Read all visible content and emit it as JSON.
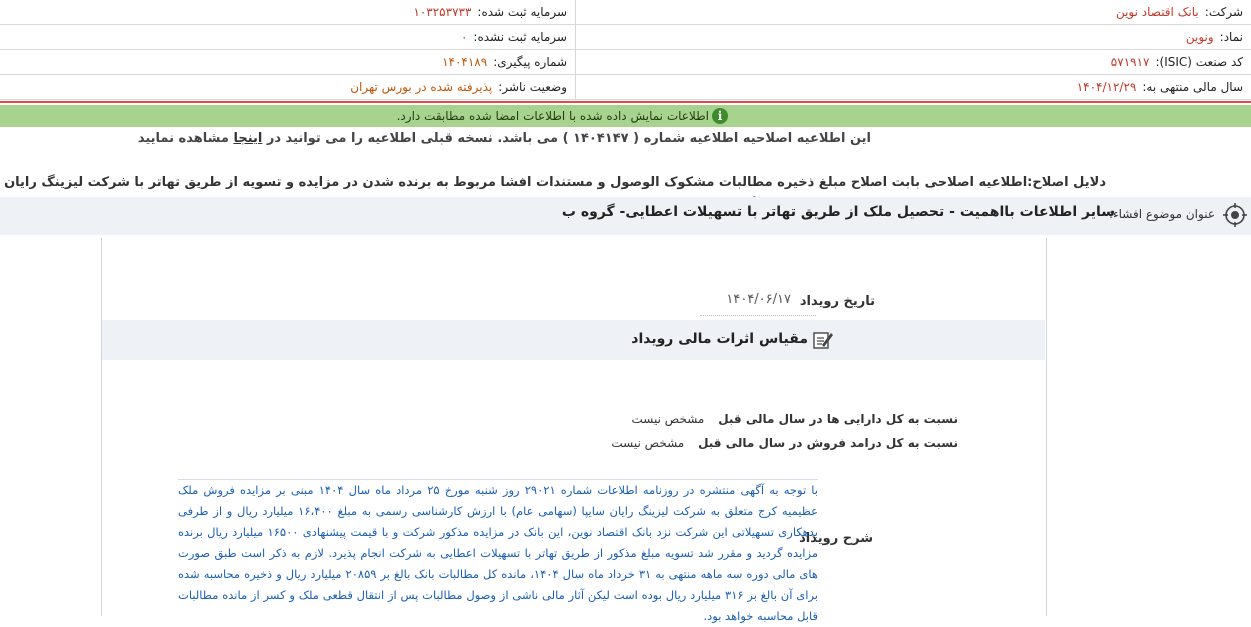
{
  "header": {
    "company_label": "شرکت:",
    "company_value": "بانک اقتصاد نوین",
    "symbol_label": "نماد:",
    "symbol_value": "ونوین",
    "isic_label": "کد صنعت (ISIC):",
    "isic_value": "۵۷۱۹۱۷",
    "fiscal_label": "سال مالی منتهی به:",
    "fiscal_value": "۱۴۰۴/۱۲/۲۹",
    "reg_capital_label": "سرمایه ثبت شده:",
    "reg_capital_value": "۱۰۳۲۵۳۷۳۳",
    "unreg_capital_label": "سرمایه ثبت نشده:",
    "unreg_capital_value": "۰",
    "tracking_label": "شماره پیگیری:",
    "tracking_value": "۱۴۰۴۱۸۹",
    "publisher_label": "وضعیت ناشر:",
    "publisher_value": "پذیرفته شده در بورس تهران"
  },
  "verify": {
    "icon": "info-icon",
    "text": "اطلاعات نمایش داده شده با اطلاعات امضا شده مطابقت دارد."
  },
  "amend": {
    "before": "این اطلاعیه اصلاحیه اطلاعیه شماره ( ۱۴۰۴۱۴۷ ) می باشد. نسخه قبلی اطلاعیه را می توانید در",
    "link": "اینجا",
    "after": "مشاهده نمایید"
  },
  "reasons": "دلایل اصلاح:اطلاعیه اصلاحی بابت اصلاح مبلغ ذخیره مطالبات مشکوک الوصول و مستندات افشا مربوط به برنده شدن در مزایده و تسویه از طریق تهاتر با شرکت لیزینگ رایان سایپا از طریق تهاتر با تسهیلات اعطایی به شرکت لیزینگ رایان سایپا می باشد.",
  "subject": {
    "label": "عنوان موضوع افشاء:",
    "value": "سایر اطلاعات بااهمیت - تحصیل ملک از طریق تهاتر با تسهیلات اعطایی- گروه ب"
  },
  "event": {
    "date_label": "تاریخ رویداد",
    "date_value": "۱۴۰۴/۰۶/۱۷"
  },
  "financial": {
    "title": "مقیاس اثرات مالی رویداد",
    "rows": [
      {
        "label": "نسبت به کل دارایی ها در سال مالی قبل",
        "value": "مشخص نیست"
      },
      {
        "label": "نسبت به کل درامد فروش در سال مالی قبل",
        "value": "مشخص نیست"
      }
    ]
  },
  "description": {
    "label": "شرح رویداد",
    "text": "با توجه به آگهی منتشره در روزنامه اطلاعات شماره ۲۹۰۲۱ روز شنبه مورخ ۲۵ مرداد ماه سال ۱۴۰۴ مبنی بر مزایده فروش ملک عظیمیه کرج متعلق به شرکت لیزینگ رایان سایپا (سهامی عام) با ارزش کارشناسی رسمی به مبلغ ۱۶،۴۰۰ میلیارد ریال و از طرفی بدهکاری تسهیلاتی این شرکت نزد بانک اقتصاد نوین، این بانک در مزایده مذکور شرکت و با قیمت پیشنهادی ۱۶۵۰۰ میلیارد ریال برنده مزایده گردید و مقرر شد تسویه مبلغ مذکور از طریق تهاتر با تسهیلات اعطایی به شرکت انجام پذیرد. لازم به ذکر است طبق صورت های مالی دوره سه ماهه منتهی به ۳۱ خرداد ماه سال ۱۴۰۴، مانده کل مطالبات بانک بالغ بر ۲۰۸۵۹ میلیارد ریال و ذخیره محاسبه شده برای آن بالغ بر ۳۱۶ میلیارد ریال بوده است لیکن آثار مالی ناشی از وصول مطالبات پس از انتقال قطعی ملک و کسر از مانده مطالبات قابل محاسبه خواهد بود."
  }
}
